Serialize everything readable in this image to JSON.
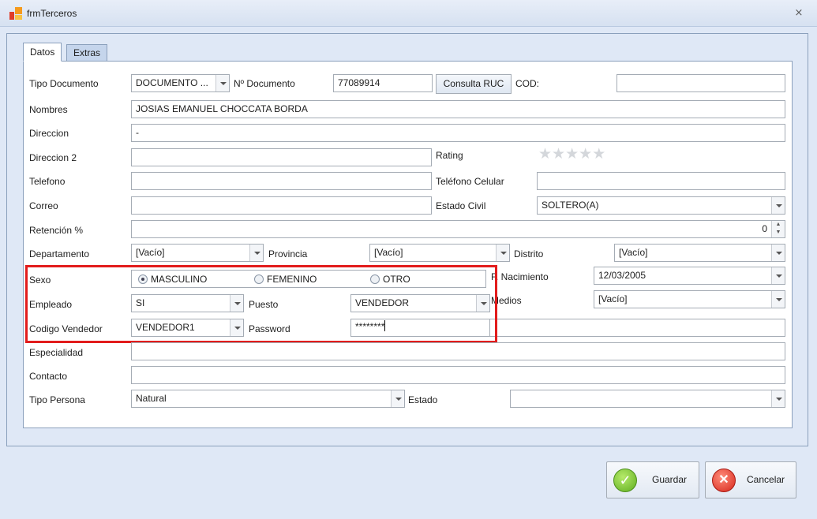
{
  "window": {
    "title": "frmTerceros",
    "close_icon": "close-icon"
  },
  "tabs": [
    {
      "label": "Datos",
      "active": true
    },
    {
      "label": "Extras",
      "active": false
    }
  ],
  "form": {
    "tipo_documento": {
      "label": "Tipo Documento",
      "value": "DOCUMENTO ..."
    },
    "nro_documento": {
      "label": "Nº Documento",
      "value": "77089914"
    },
    "consulta_ruc": {
      "label": "Consulta RUC"
    },
    "cod": {
      "label": "COD:",
      "value": ""
    },
    "nombres": {
      "label": "Nombres",
      "value": "JOSIAS EMANUEL CHOCCATA BORDA"
    },
    "direccion": {
      "label": "Direccion",
      "value": "-"
    },
    "direccion2": {
      "label": "Direccion 2",
      "value": ""
    },
    "rating": {
      "label": "Rating",
      "value": 0,
      "max": 5
    },
    "telefono": {
      "label": "Telefono",
      "value": ""
    },
    "telefono_celular": {
      "label": "Teléfono Celular",
      "value": ""
    },
    "correo": {
      "label": "Correo",
      "value": ""
    },
    "estado_civil": {
      "label": "Estado Civil",
      "value": "SOLTERO(A)"
    },
    "retencion": {
      "label": "Retención %",
      "value": "0"
    },
    "departamento": {
      "label": "Departamento",
      "value": "[Vacío]"
    },
    "provincia": {
      "label": "Provincia",
      "value": "[Vacío]"
    },
    "distrito": {
      "label": "Distrito",
      "value": "[Vacío]"
    },
    "sexo": {
      "label": "Sexo",
      "options": [
        "MASCULINO",
        "FEMENINO",
        "OTRO"
      ],
      "selected": "MASCULINO"
    },
    "f_nacimiento": {
      "label": "F. Nacimiento",
      "value": "12/03/2005"
    },
    "empleado": {
      "label": "Empleado",
      "value": "SI"
    },
    "puesto": {
      "label": "Puesto",
      "value": "VENDEDOR"
    },
    "medios": {
      "label": "Medios",
      "value": "[Vacío]"
    },
    "codigo_vendedor": {
      "label": "Codigo Vendedor",
      "value": "VENDEDOR1"
    },
    "password": {
      "label": "Password",
      "value": "********"
    },
    "especialidad": {
      "label": "Especialidad",
      "value": ""
    },
    "contacto": {
      "label": "Contacto",
      "value": ""
    },
    "tipo_persona": {
      "label": "Tipo Persona",
      "value": "Natural"
    },
    "estado": {
      "label": "Estado",
      "value": ""
    }
  },
  "footer": {
    "guardar_label": "Guardar",
    "cancelar_label": "Cancelar"
  },
  "colors": {
    "highlight_frame": "#e21c1c",
    "background": "#dfe8f6"
  }
}
